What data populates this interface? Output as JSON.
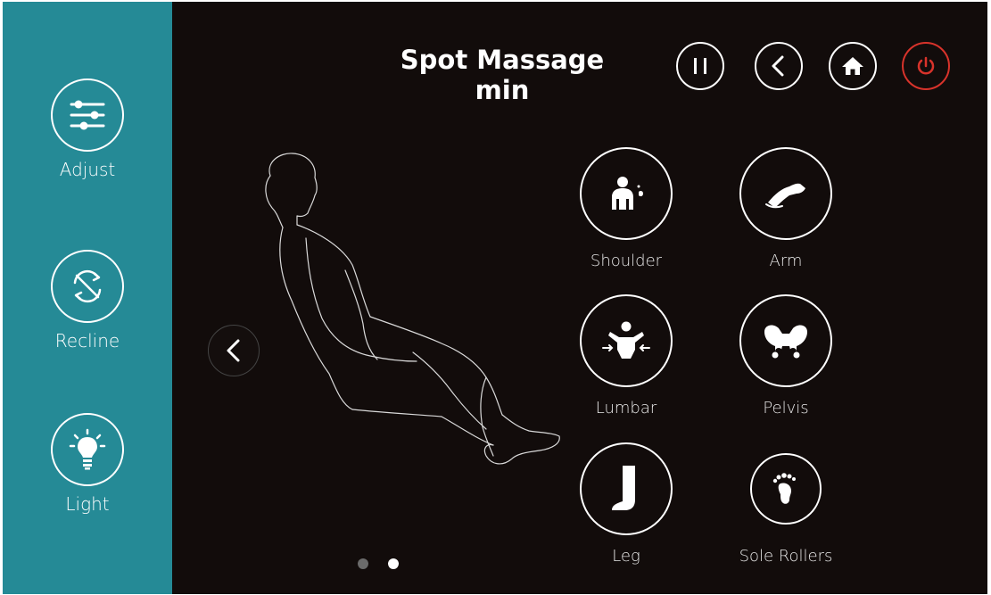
{
  "header": {
    "title_line1": "Spot Massage",
    "title_line2": "min"
  },
  "top_buttons": [
    {
      "icon": "pause-icon"
    },
    {
      "icon": "chevron-left-icon"
    },
    {
      "icon": "home-icon"
    },
    {
      "icon": "power-icon",
      "color": "#d8332b"
    }
  ],
  "sidebar": {
    "background": "#258a96",
    "items": [
      {
        "label": "Adjust",
        "icon": "sliders-icon"
      },
      {
        "label": "Recline",
        "icon": "recline-arrows-icon"
      },
      {
        "label": "Light",
        "icon": "lightbulb-icon"
      }
    ]
  },
  "body_parts": [
    {
      "label": "Shoulder",
      "icon": "shoulder-icon"
    },
    {
      "label": "Arm",
      "icon": "arm-icon"
    },
    {
      "label": "Lumbar",
      "icon": "lumbar-icon"
    },
    {
      "label": "Pelvis",
      "icon": "pelvis-icon"
    },
    {
      "label": "Leg",
      "icon": "leg-icon"
    },
    {
      "label": "Sole Rollers",
      "icon": "foot-icon"
    }
  ],
  "pagination": {
    "current_page": 2,
    "total_pages": 2
  }
}
